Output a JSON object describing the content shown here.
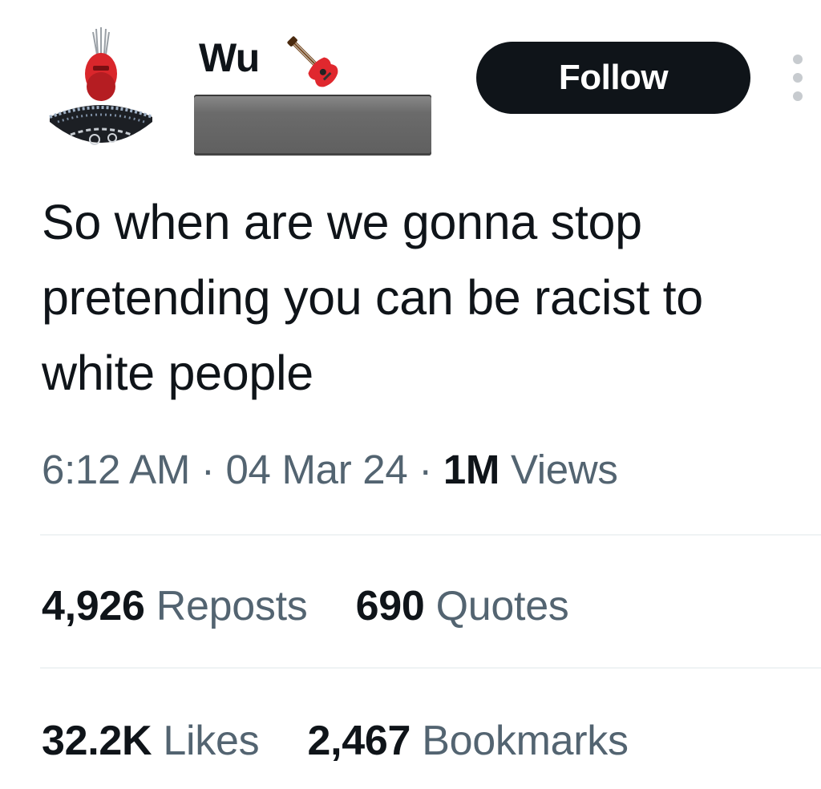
{
  "user": {
    "display_name": "Wu",
    "name_emoji": "guitar-icon"
  },
  "follow_label": "Follow",
  "tweet": {
    "text": "So when are we gonna stop pretending you can be racist to white people"
  },
  "meta": {
    "time": "6:12 AM",
    "separator": "·",
    "date": "04 Mar 24",
    "views_count": "1M",
    "views_label": "Views"
  },
  "stats": {
    "reposts_count": "4,926",
    "reposts_label": "Reposts",
    "quotes_count": "690",
    "quotes_label": "Quotes",
    "likes_count": "32.2K",
    "likes_label": "Likes",
    "bookmarks_count": "2,467",
    "bookmarks_label": "Bookmarks"
  },
  "colors": {
    "text_primary": "#0f1419",
    "text_secondary": "#536471",
    "button_bg": "#0f1419",
    "divider": "#eff3f4"
  }
}
